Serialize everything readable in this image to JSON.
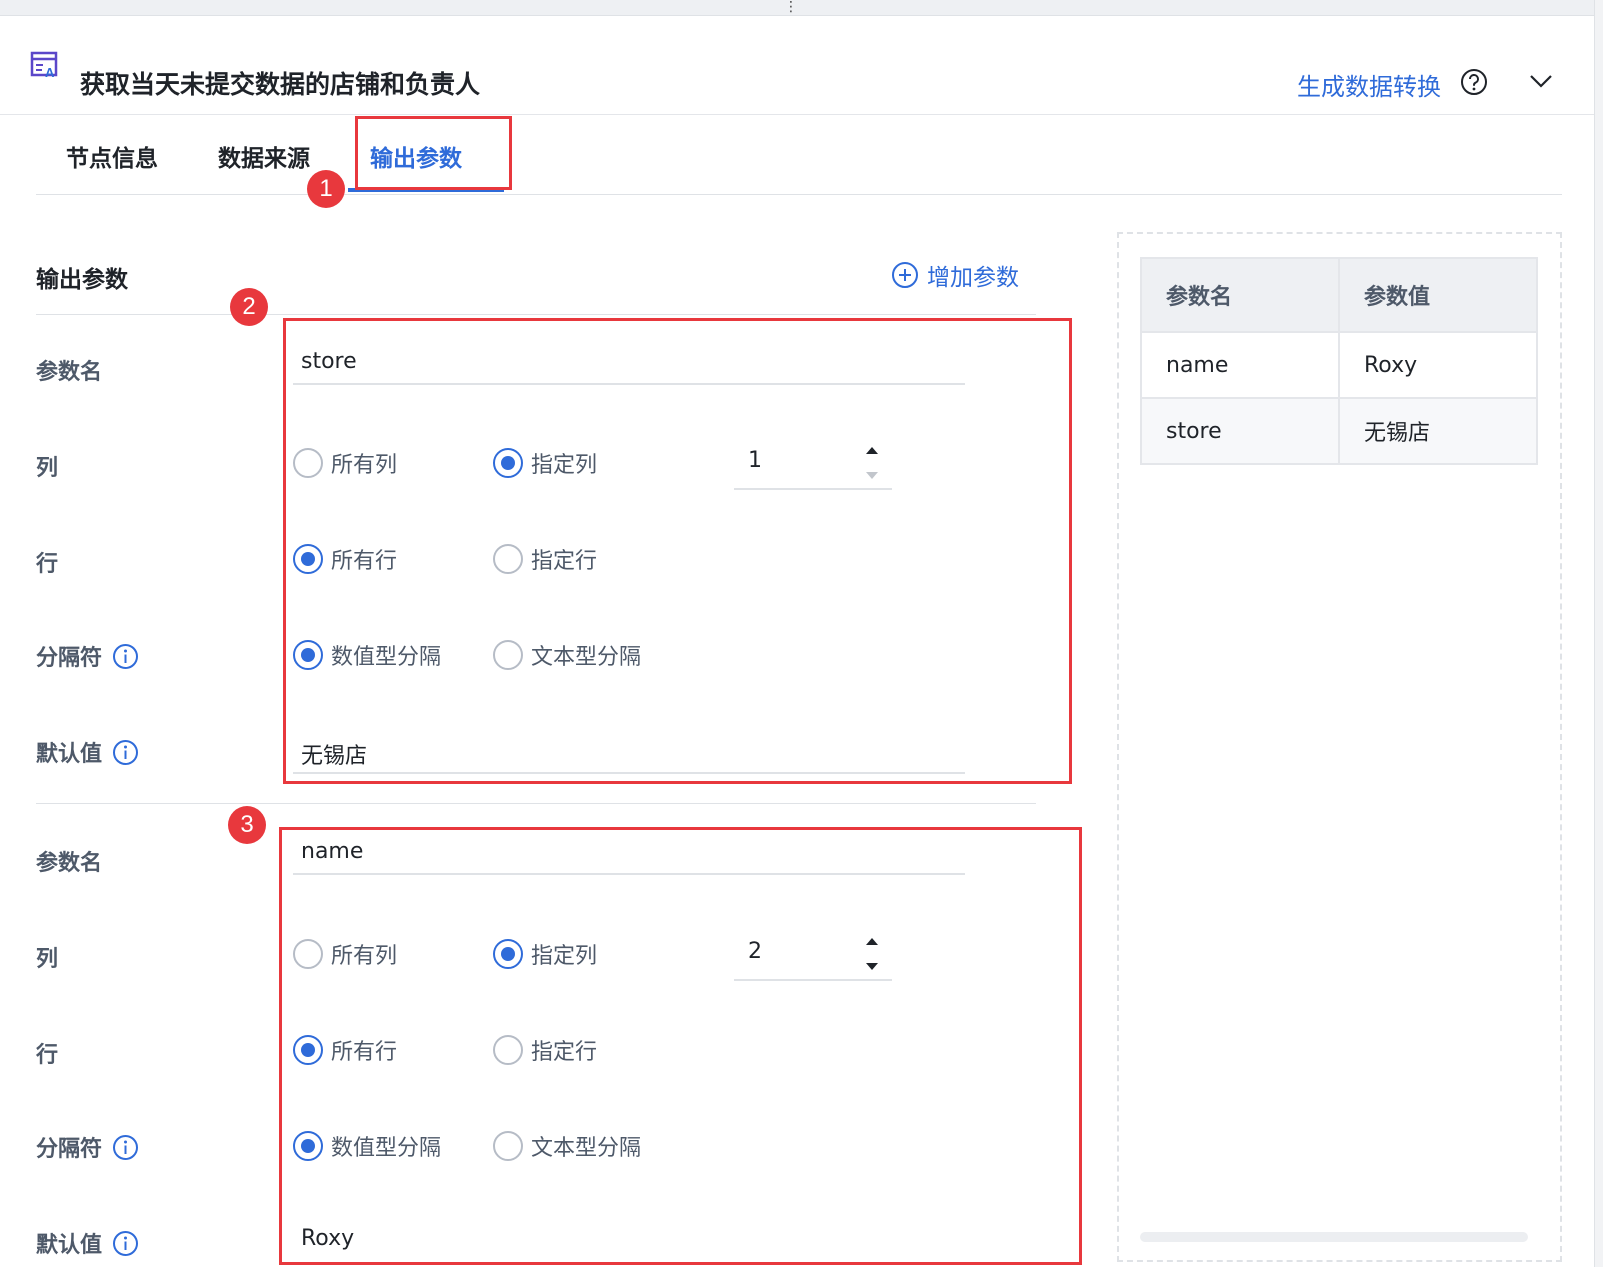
{
  "window": {
    "drag_handle": "⋮"
  },
  "header": {
    "title": "获取当天未提交数据的店铺和负责人",
    "generate_link": "生成数据转换"
  },
  "tabs": [
    {
      "label": "节点信息"
    },
    {
      "label": "数据来源"
    },
    {
      "label": "输出参数",
      "active": true
    }
  ],
  "section": {
    "title": "输出参数",
    "add_param": "增加参数"
  },
  "labels": {
    "param_name": "参数名",
    "column": "列",
    "row": "行",
    "separator": "分隔符",
    "default_value": "默认值"
  },
  "options": {
    "all_columns": "所有列",
    "specified_column": "指定列",
    "all_rows": "所有行",
    "specified_row": "指定行",
    "numeric_separator": "数值型分隔",
    "text_separator": "文本型分隔"
  },
  "params": [
    {
      "name": "store",
      "column_mode": "specified",
      "column_index": "1",
      "row_mode": "all",
      "separator_mode": "numeric",
      "default_value": "无锡店"
    },
    {
      "name": "name",
      "column_mode": "specified",
      "column_index": "2",
      "row_mode": "all",
      "separator_mode": "numeric",
      "default_value": "Roxy"
    }
  ],
  "annotations": [
    "1",
    "2",
    "3"
  ],
  "preview": {
    "columns": [
      "参数名",
      "参数值"
    ],
    "rows": [
      [
        "name",
        "Roxy"
      ],
      [
        "store",
        "无锡店"
      ]
    ]
  },
  "colors": {
    "accent": "#2f6bd9",
    "annotation": "#e8383d"
  },
  "icons": [
    "node-transform-icon",
    "help-circle-icon",
    "chevron-down-icon",
    "plus-circle-icon",
    "info-icon",
    "stepper-up-icon",
    "stepper-down-icon"
  ]
}
